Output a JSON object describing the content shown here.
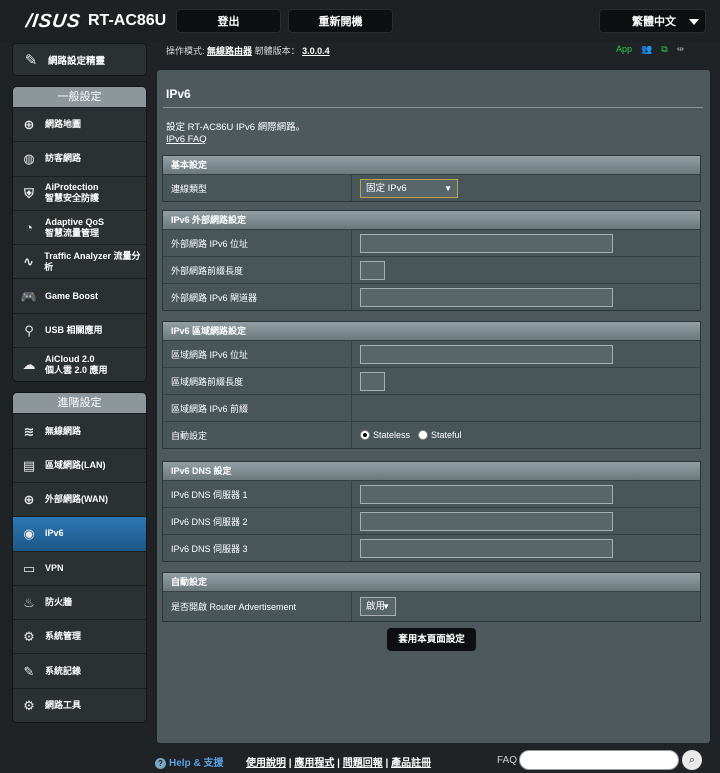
{
  "header": {
    "brand": "/ISUS",
    "model": "RT-AC86U",
    "logout": "登出",
    "reboot": "重新開機",
    "language": "繁體中文"
  },
  "status": {
    "mode_label": "操作模式:",
    "mode_value": "無線路由器",
    "firmware_label": "韌體版本：",
    "firmware_value": "3.0.0.4",
    "app": "App"
  },
  "nav": {
    "wizard": "網路設定精靈",
    "general_title": "一般設定",
    "general": [
      {
        "label": "網路地圖",
        "icon": "network-map-icon"
      },
      {
        "label": "訪客網路",
        "icon": "guest-network-icon"
      },
      {
        "label": "AiProtection\n智慧安全防護",
        "icon": "aiprotection-icon"
      },
      {
        "label": "Adaptive QoS\n智慧流量管理",
        "icon": "qos-icon"
      },
      {
        "label": "Traffic Analyzer 流量分析",
        "icon": "traffic-analyzer-icon"
      },
      {
        "label": "Game Boost",
        "icon": "gamepad-icon"
      },
      {
        "label": "USB 相關應用",
        "icon": "usb-icon"
      },
      {
        "label": "AiCloud 2.0\n個人雲 2.0 應用",
        "icon": "cloud-icon"
      }
    ],
    "advanced_title": "進階設定",
    "advanced": [
      {
        "label": "無線網路",
        "icon": "wireless-icon"
      },
      {
        "label": "區域網路(LAN)",
        "icon": "lan-icon"
      },
      {
        "label": "外部網路(WAN)",
        "icon": "wan-icon"
      },
      {
        "label": "IPv6",
        "icon": "ipv6-icon"
      },
      {
        "label": "VPN",
        "icon": "vpn-icon"
      },
      {
        "label": "防火牆",
        "icon": "firewall-icon"
      },
      {
        "label": "系統管理",
        "icon": "administration-icon"
      },
      {
        "label": "系統記錄",
        "icon": "system-log-icon"
      },
      {
        "label": "網路工具",
        "icon": "network-tools-icon"
      }
    ]
  },
  "page": {
    "title": "IPv6",
    "description": "設定 RT-AC86U IPv6 網際網路。",
    "faq_link": "IPv6 FAQ"
  },
  "basic": {
    "heading": "基本設定",
    "conn_type_label": "連線類型",
    "conn_type_value": "固定 IPv6"
  },
  "wan": {
    "heading": "IPv6 外部網路設定",
    "address_label": "外部網路 IPv6 位址",
    "prefix_len_label": "外部網路前綴長度",
    "gateway_label": "外部網路 IPv6 閘道器"
  },
  "lan": {
    "heading": "IPv6 區域網路設定",
    "address_label": "區域網路 IPv6 位址",
    "prefix_len_label": "區域網路前綴長度",
    "prefix_label": "區域網路 IPv6 前綴",
    "autoconf_label": "自動設定",
    "stateless": "Stateless",
    "stateful": "Stateful"
  },
  "dns": {
    "heading": "IPv6 DNS 設定",
    "dns1_label": "IPv6 DNS 伺服器 1",
    "dns2_label": "IPv6 DNS 伺服器 2",
    "dns3_label": "IPv6 DNS 伺服器 3"
  },
  "auto": {
    "heading": "自動設定",
    "ra_label": "是否開啟 Router Advertisement",
    "ra_value": "啟用"
  },
  "apply": "套用本頁面設定",
  "footer": {
    "help": "Help & 支援",
    "manual": "使用說明",
    "utility": "應用程式",
    "feedback": "問題回報",
    "registration": "產品註冊",
    "faq": "FAQ"
  },
  "colors": {
    "active_nav": "#2d79b4",
    "panel": "#4d595d",
    "help_link": "#5aa0e4",
    "status_green": "#2fd14a"
  }
}
